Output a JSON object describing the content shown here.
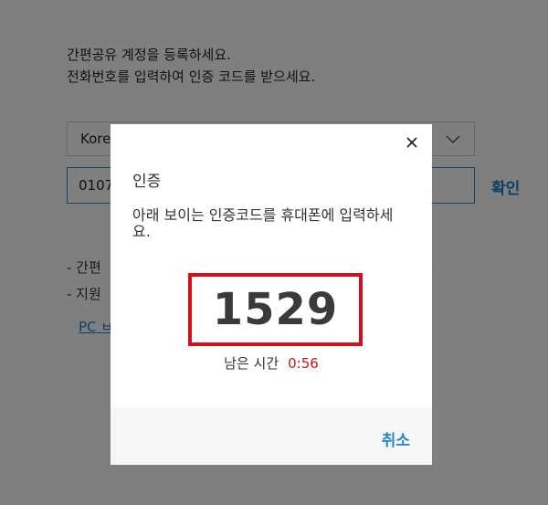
{
  "page": {
    "intro_line_1": "간편공유 계정을 등록하세요.",
    "intro_line_2": "전화번호를 입력하여 인증 코드를 받으세요.",
    "country_value": "Kore",
    "phone_value": "0107",
    "confirm_label": "확인",
    "note_1": "- 간편",
    "note_2": "- 지원",
    "note_dot": ".",
    "pc_link": "PC ㅂ"
  },
  "dialog": {
    "title": "인증",
    "description": "아래 보이는 인증코드를 휴대폰에 입력하세요.",
    "code": "1529",
    "timer_label": "남은 시간",
    "timer_value": "0:56",
    "cancel_label": "취소"
  },
  "colors": {
    "accent_blue": "#1f7fc8",
    "highlight_red": "#d0101a",
    "overlay": "rgba(0,0,0,0.5)"
  },
  "icons": {
    "close": "close-icon",
    "dropdown": "chevron-down-icon"
  }
}
